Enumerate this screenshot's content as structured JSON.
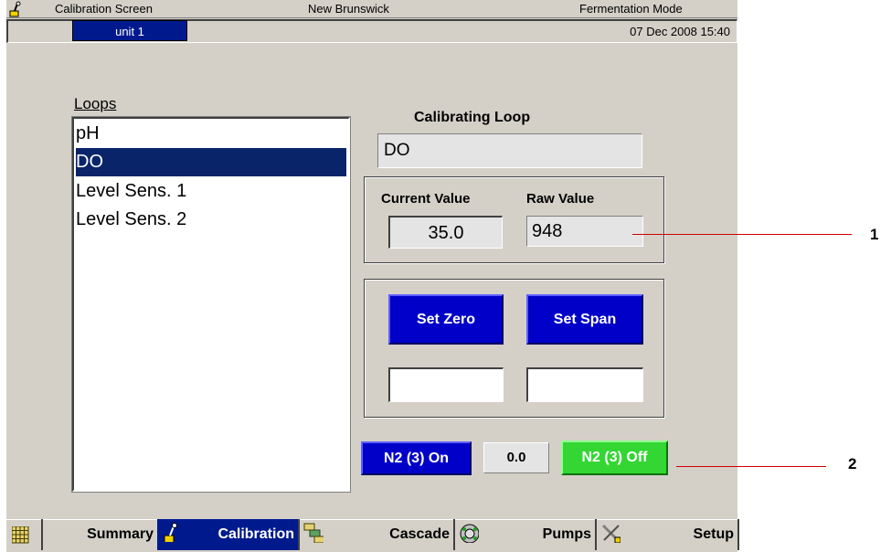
{
  "titlebar": {
    "screen_name": "Calibration Screen",
    "company": "New Brunswick",
    "mode": "Fermentation Mode",
    "icon": "probe-icon"
  },
  "header": {
    "unit_tab": "unit 1",
    "datetime": "07 Dec 2008  15:40"
  },
  "loops": {
    "heading": "Loops",
    "items": [
      "pH",
      "DO",
      "Level Sens. 1",
      "Level Sens. 2"
    ],
    "selected": "DO"
  },
  "calibrating": {
    "label": "Calibrating Loop",
    "value": "DO"
  },
  "values": {
    "current_label": "Current Value",
    "current": "35.0",
    "raw_label": "Raw Value",
    "raw": "948"
  },
  "actions": {
    "set_zero": "Set Zero",
    "set_span": "Set Span",
    "zero_value": "",
    "span_value": ""
  },
  "n2": {
    "on_label": "N2 (3) On",
    "value": "0.0",
    "off_label": "N2 (3) Off"
  },
  "callouts": [
    "1",
    "2"
  ],
  "nav": {
    "items": [
      {
        "label": "",
        "icon": "grid-icon"
      },
      {
        "label": "Summary",
        "icon": "probe-icon"
      },
      {
        "label": "Calibration",
        "icon": "cascade-icon"
      },
      {
        "label": "Cascade",
        "icon": "pump-icon"
      },
      {
        "label": "Pumps",
        "icon": "tools-icon"
      },
      {
        "label": "Setup",
        "icon": ""
      }
    ],
    "active": "Calibration"
  },
  "colors": {
    "panel": "#d4d0c8",
    "selection": "#0a246a",
    "blue_button": "#0000c8",
    "green_button": "#33d633",
    "callout_line": "#d00000"
  }
}
